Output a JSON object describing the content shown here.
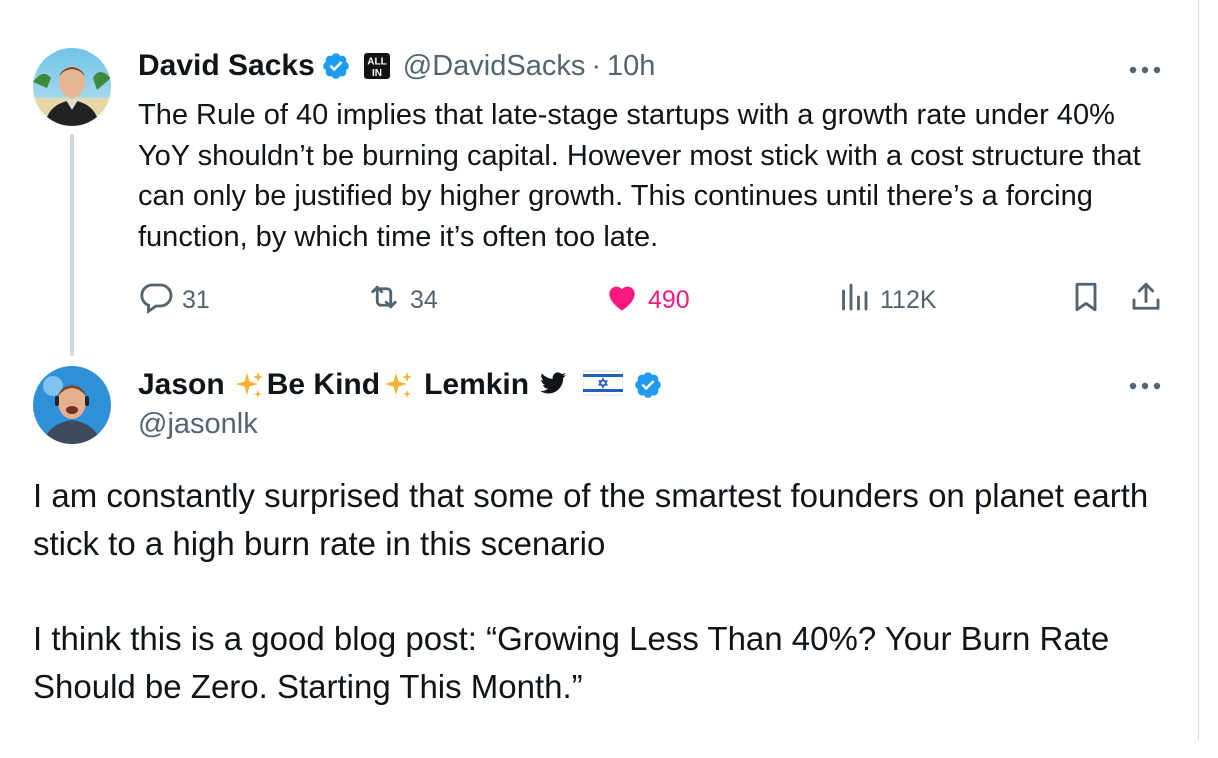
{
  "parent_tweet": {
    "author_name": "David Sacks",
    "handle": "@DavidSacks",
    "separator": "·",
    "time": "10h",
    "affiliate_badge": "ALL IN",
    "text": "The Rule of 40 implies that late-stage startups with a growth rate under 40% YoY shouldn’t be burning capital. However most stick with a cost structure that can only be justified by higher growth. This continues until there’s a forcing function, by which time it’s often too late.",
    "actions": {
      "replies": "31",
      "reposts": "34",
      "likes": "490",
      "views": "112K"
    }
  },
  "main_tweet": {
    "author_name_parts": [
      "Jason",
      "Be Kind",
      "Lemkin"
    ],
    "handle": "@jasonlk",
    "paragraphs": [
      "I am constantly surprised that some of the smartest founders on planet earth stick to a high burn rate in this scenario",
      "I think this is a good blog post:  “Growing Less Than 40%?  Your Burn Rate Should be Zero.  Starting This Month.”"
    ]
  },
  "colors": {
    "text": "#0f1419",
    "secondary": "#536471",
    "verified": "#1d9bf0",
    "like": "#f91880",
    "thread_line": "#cfd9de"
  },
  "icons": [
    "verified-badge-icon",
    "allin-badge-icon",
    "more-icon",
    "reply-icon",
    "retweet-icon",
    "heart-icon",
    "views-icon",
    "bookmark-icon",
    "share-icon",
    "sparkles-icon",
    "twitter-bird-icon",
    "israel-flag-icon"
  ]
}
